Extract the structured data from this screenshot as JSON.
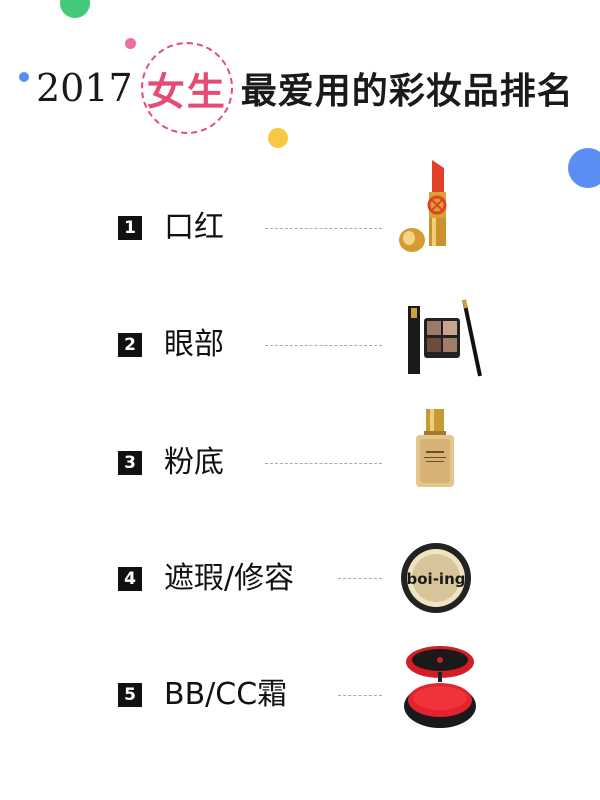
{
  "header": {
    "year": "2017",
    "highlight": "女生",
    "rest": "最爱用的彩妆品排名"
  },
  "colors": {
    "accent": "#e64b73",
    "green": "#42c97a",
    "blue": "#5c8df2",
    "yellow": "#f7c843",
    "pink": "#ee6da3"
  },
  "ranking": [
    {
      "rank": "1",
      "label": "口红"
    },
    {
      "rank": "2",
      "label": "眼部"
    },
    {
      "rank": "3",
      "label": "粉底"
    },
    {
      "rank": "4",
      "label": "遮瑕/修容"
    },
    {
      "rank": "5",
      "label": "BB/CC霜"
    }
  ],
  "products": {
    "concealer_text": "boi-ing"
  }
}
